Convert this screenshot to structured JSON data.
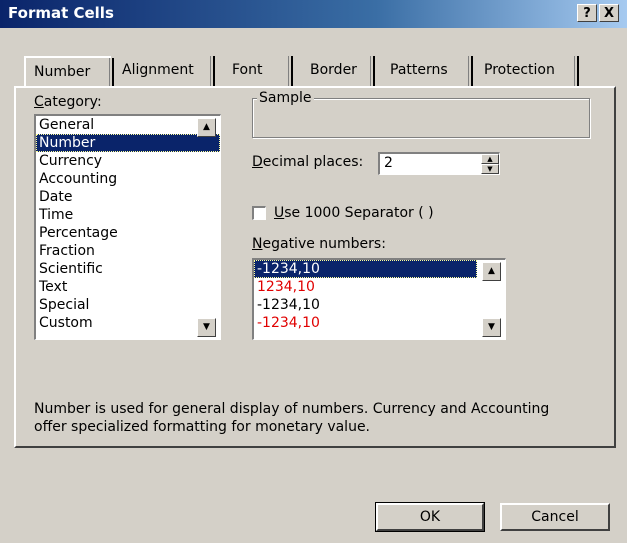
{
  "window": {
    "title": "Format Cells",
    "help_glyph": "?",
    "close_glyph": "X"
  },
  "tabs": [
    {
      "label": "Number"
    },
    {
      "label": "Alignment"
    },
    {
      "label": "Font"
    },
    {
      "label": "Border"
    },
    {
      "label": "Patterns"
    },
    {
      "label": "Protection"
    }
  ],
  "category": {
    "label_prefix": "",
    "label_access": "C",
    "label_rest": "ategory:",
    "items": [
      "General",
      "Number",
      "Currency",
      "Accounting",
      "Date",
      "Time",
      "Percentage",
      "Fraction",
      "Scientific",
      "Text",
      "Special",
      "Custom"
    ],
    "selected_index": 1
  },
  "sample": {
    "legend": "Sample"
  },
  "decimal": {
    "label_access": "D",
    "label_rest": "ecimal places:",
    "value": "2"
  },
  "separator": {
    "label_access": "U",
    "label_rest": "se 1000 Separator ( )",
    "checked": false
  },
  "negative": {
    "label_access": "N",
    "label_rest": "egative numbers:",
    "items": [
      {
        "text": "-1234,10",
        "color": "#000000"
      },
      {
        "text": "1234,10",
        "color": "#e00000"
      },
      {
        "text": "-1234,10",
        "color": "#000000"
      },
      {
        "text": "-1234,10",
        "color": "#e00000"
      }
    ],
    "selected_index": 0
  },
  "description": {
    "line1": "Number is used for general display of numbers.  Currency and Accounting",
    "line2": "offer specialized formatting for monetary value."
  },
  "buttons": {
    "ok": "OK",
    "cancel": "Cancel"
  }
}
